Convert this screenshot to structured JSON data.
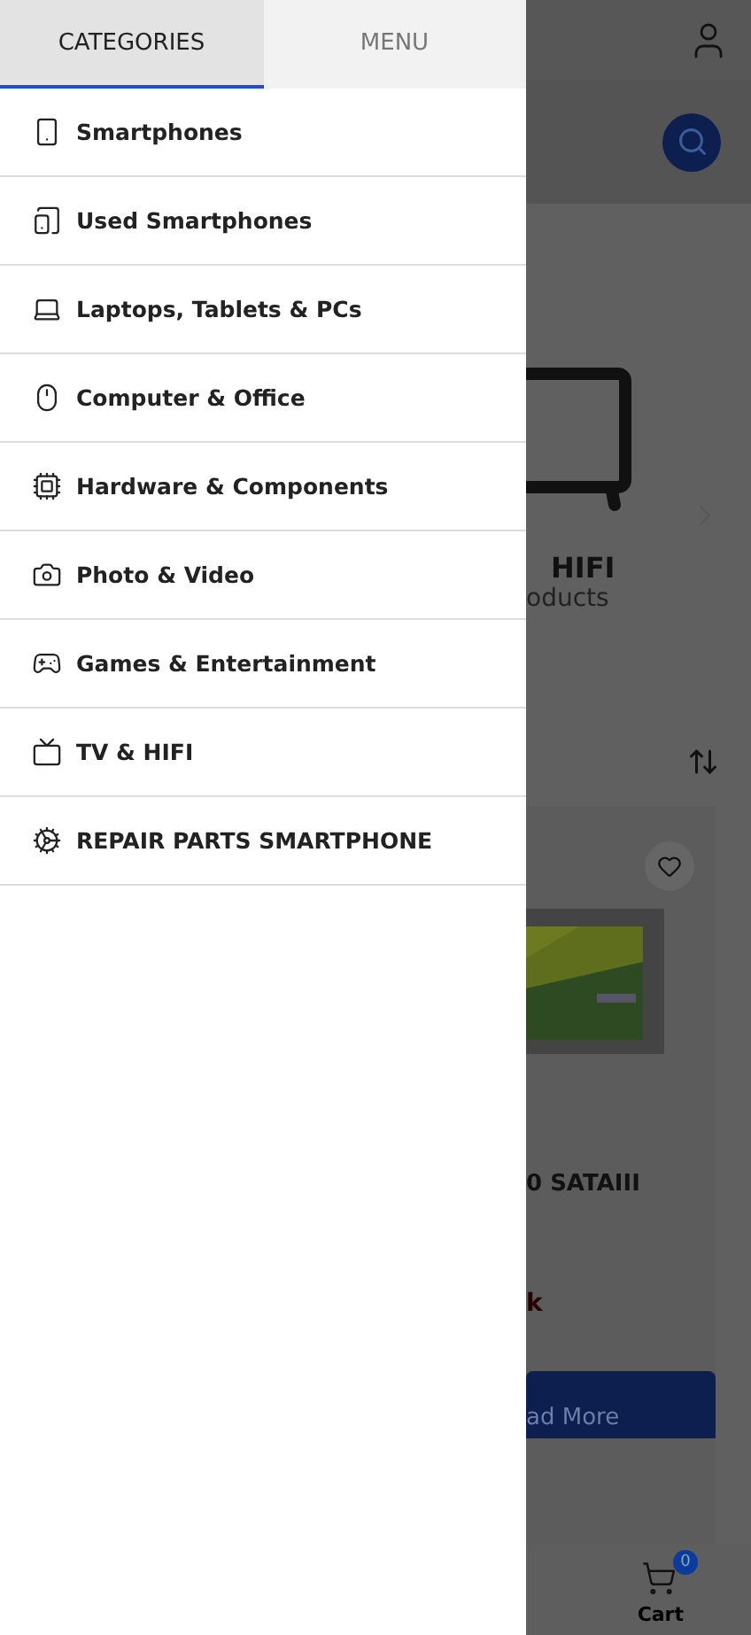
{
  "drawer": {
    "tabs": [
      {
        "label": "CATEGORIES",
        "selected": true
      },
      {
        "label": "MENU",
        "selected": false
      }
    ],
    "categories": [
      "Smartphones",
      "Used Smartphones",
      "Laptops, Tablets & PCs",
      "Computer & Office",
      "Hardware & Components",
      "Photo & Video",
      "Games & Entertainment",
      "TV & HIFI",
      "REPAIR PARTS SMARTPHONE"
    ]
  },
  "page_behind": {
    "banner_title": "HIFI",
    "banner_subtitle": "oducts",
    "product_title": "0 SATAIII",
    "stock_status": "k",
    "product_button": "ad More",
    "cart_label": "Cart",
    "cart_count": "0"
  }
}
